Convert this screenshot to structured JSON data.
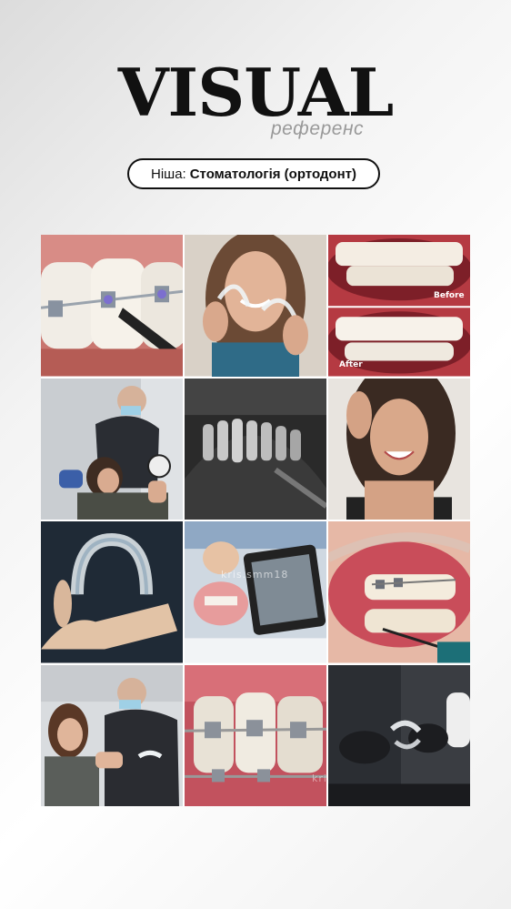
{
  "header": {
    "title": "VISUAL",
    "subtitle": "референс"
  },
  "niche": {
    "label": "Ніша:",
    "value": "Стоматологія (ортодонт)"
  },
  "gallery": {
    "before_label": "Before",
    "after_label": "After",
    "watermark": "kris.smm18"
  }
}
